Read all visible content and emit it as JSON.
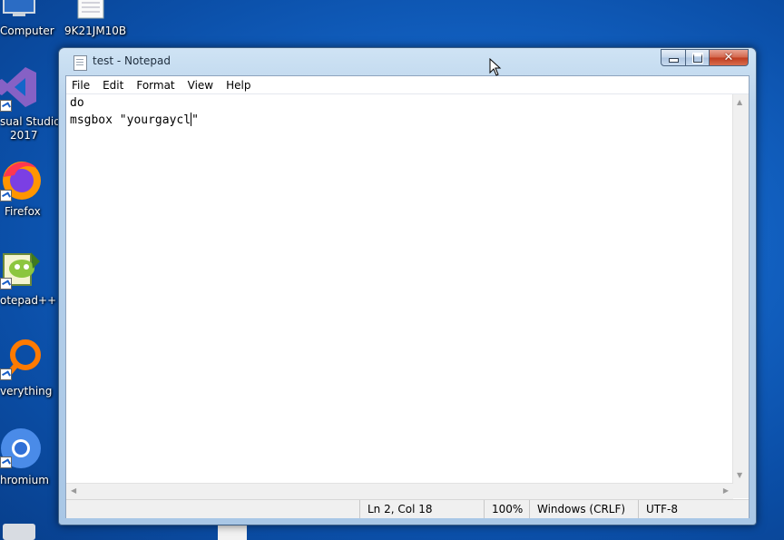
{
  "desktop": {
    "icons": [
      {
        "label": "Computer",
        "icon": "computer-icon"
      },
      {
        "label": "9K21JM10B",
        "icon": "text-file-icon"
      },
      {
        "label": "sual Studio\n2017",
        "label_line1": "sual Studio",
        "label_line2": "2017",
        "icon": "visual-studio-icon"
      },
      {
        "label": "Firefox",
        "icon": "firefox-icon"
      },
      {
        "label": "otepad++",
        "icon": "notepad-plus-plus-icon"
      },
      {
        "label": "verything",
        "icon": "everything-search-icon"
      },
      {
        "label": "hromium",
        "icon": "chromium-icon"
      }
    ]
  },
  "window": {
    "title": "test - Notepad",
    "menu": [
      "File",
      "Edit",
      "Format",
      "View",
      "Help"
    ],
    "editor_lines": [
      "do",
      "msgbox \"yourgaycl",
      "\""
    ],
    "status": {
      "position": "Ln 2, Col 18",
      "zoom": "100%",
      "line_endings": "Windows (CRLF)",
      "encoding": "UTF-8"
    }
  },
  "colors": {
    "desktop_bg": "#1466c9",
    "close_button": "#c03b1e",
    "window_frame": "#b9d3ec"
  }
}
